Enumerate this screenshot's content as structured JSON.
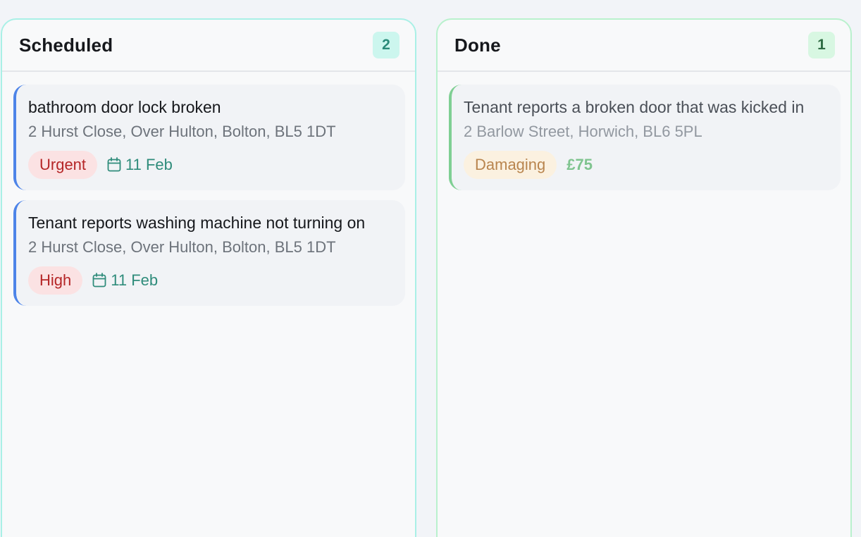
{
  "columns": [
    {
      "title": "Scheduled",
      "count": "2",
      "cards": [
        {
          "title": "bathroom door lock broken",
          "address": "2 Hurst Close, Over Hulton, Bolton, BL5 1DT",
          "priority": "Urgent",
          "date": "11 Feb"
        },
        {
          "title": "Tenant reports washing machine not turning on",
          "address": "2 Hurst Close, Over Hulton, Bolton, BL5 1DT",
          "priority": "High",
          "date": "11 Feb"
        }
      ]
    },
    {
      "title": "Done",
      "count": "1",
      "cards": [
        {
          "title": "Tenant reports a broken door that was kicked in",
          "address": "2 Barlow Street, Horwich, BL6 5PL",
          "tag": "Damaging",
          "amount": "£75"
        }
      ]
    }
  ],
  "colors": {
    "scheduled_border": "#a9f0e6",
    "done_border": "#b9f1cd",
    "card_accent_blue": "#4d84e8",
    "card_accent_green": "#7fcf93",
    "urgent_text": "#b52627",
    "date_text": "#2f8c7b",
    "amount_text": "#7fc48f"
  },
  "icons": {
    "date": "calendar-icon"
  }
}
